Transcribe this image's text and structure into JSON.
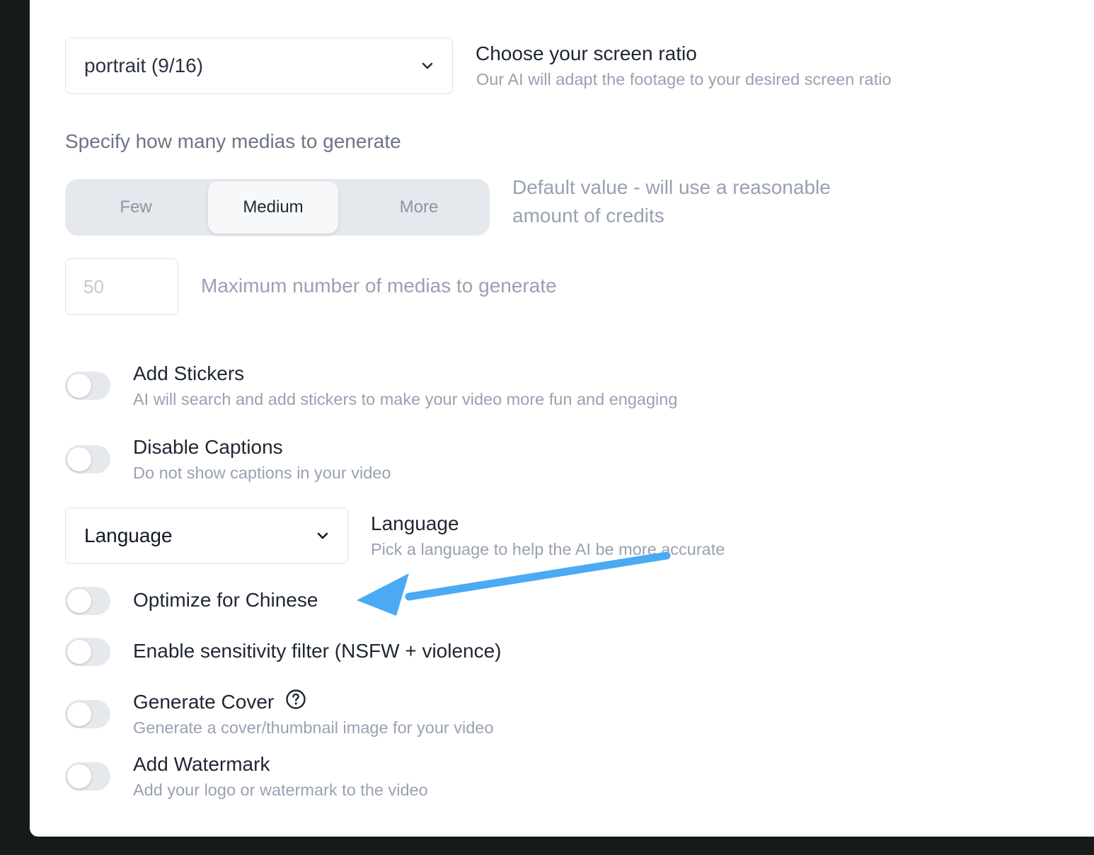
{
  "ratio": {
    "select_value": "portrait (9/16)",
    "title": "Choose your screen ratio",
    "description": "Our AI will adapt the footage to your desired screen ratio",
    "chevron_icon": "chevron-down-icon"
  },
  "medias": {
    "label": "Specify how many medias to generate",
    "options": [
      "Few",
      "Medium",
      "More"
    ],
    "selected": "Medium",
    "hint_line1": "Default value - will use a reasonable",
    "hint_line2": "amount of credits",
    "max_placeholder": "50",
    "max_label": "Maximum number of medias to generate"
  },
  "toggles": {
    "stickers": {
      "title": "Add Stickers",
      "description": "AI will search and add stickers to make your video more fun and engaging",
      "on": false
    },
    "captions": {
      "title": "Disable Captions",
      "description": "Do not show captions in your video",
      "on": false
    },
    "chinese": {
      "title": "Optimize for Chinese",
      "on": false
    },
    "sensitivity": {
      "title": "Enable sensitivity filter (NSFW + violence)",
      "on": false
    },
    "cover": {
      "title": "Generate Cover",
      "description": "Generate a cover/thumbnail image for your video",
      "on": false,
      "help_icon": "question-circle-icon"
    },
    "watermark": {
      "title": "Add Watermark",
      "description": "Add your logo or watermark to the video",
      "on": false
    }
  },
  "language": {
    "select_value": "Language",
    "title": "Language",
    "description": "Pick a language to help the AI be more accurate"
  },
  "annotation": {
    "arrow_color": "#4aaaf3",
    "arrow_icon": "arrow-annotation"
  }
}
